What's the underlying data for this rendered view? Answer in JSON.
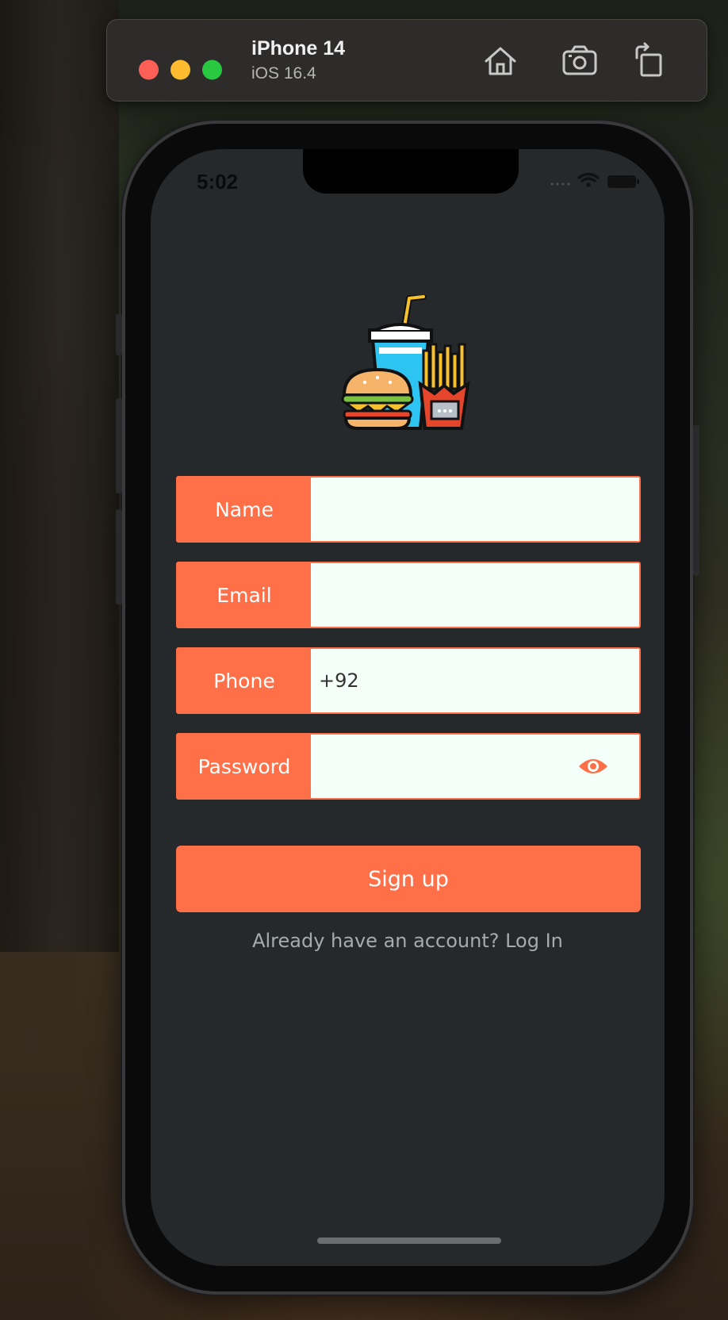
{
  "simulator": {
    "device_name": "iPhone 14",
    "os_version": "iOS 16.4"
  },
  "status_bar": {
    "time": "5:02"
  },
  "form": {
    "name_label": "Name",
    "email_label": "Email",
    "phone_label": "Phone",
    "phone_value": "+92",
    "password_label": "Password"
  },
  "signup_button": "Sign up",
  "login_prompt": "Already have an account? Log In",
  "colors": {
    "accent": "#ff7049",
    "background": "#25292c",
    "input_bg": "#f5fffa"
  }
}
